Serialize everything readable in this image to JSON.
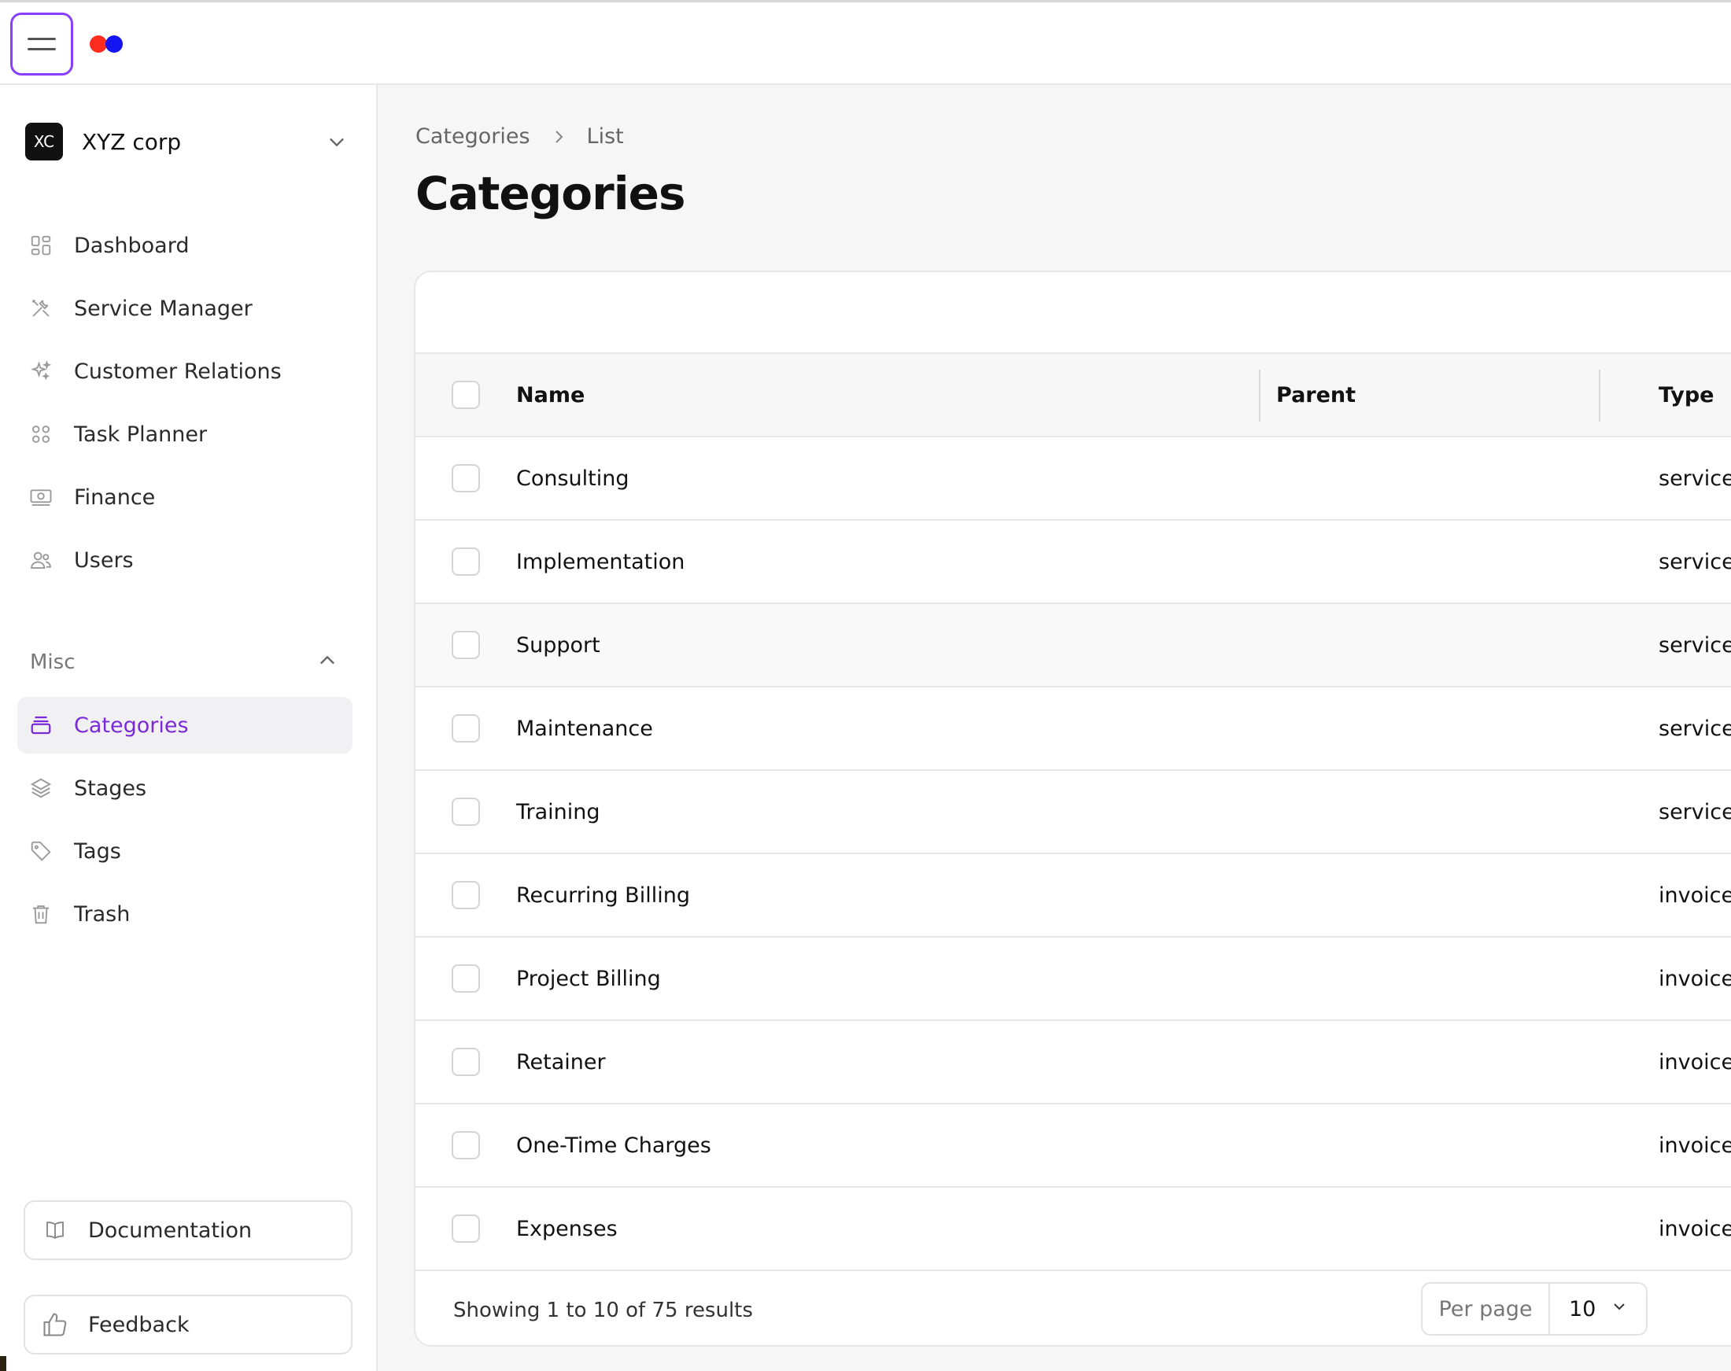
{
  "header": {
    "menu_icon": "hamburger-icon",
    "logo_colors": [
      "#ff2d20",
      "#1414f0"
    ]
  },
  "org": {
    "initials": "XC",
    "name": "XYZ corp"
  },
  "nav": [
    {
      "label": "Dashboard",
      "icon": "dashboard-icon"
    },
    {
      "label": "Service Manager",
      "icon": "tools-icon"
    },
    {
      "label": "Customer Relations",
      "icon": "sparkles-icon"
    },
    {
      "label": "Task Planner",
      "icon": "grid-icon"
    },
    {
      "label": "Finance",
      "icon": "banknote-icon"
    },
    {
      "label": "Users",
      "icon": "users-icon"
    }
  ],
  "misc": {
    "label": "Misc",
    "items": [
      {
        "label": "Categories",
        "icon": "archive-box-icon",
        "active": true
      },
      {
        "label": "Stages",
        "icon": "layers-icon"
      },
      {
        "label": "Tags",
        "icon": "tag-icon"
      },
      {
        "label": "Trash",
        "icon": "trash-icon"
      }
    ]
  },
  "footer_buttons": {
    "documentation": "Documentation",
    "feedback": "Feedback"
  },
  "breadcrumb": {
    "root": "Categories",
    "current": "List"
  },
  "page_title": "Categories",
  "table": {
    "headers": {
      "name": "Name",
      "parent": "Parent",
      "type": "Type"
    },
    "rows": [
      {
        "name": "Consulting",
        "parent": "",
        "type": "services"
      },
      {
        "name": "Implementation",
        "parent": "",
        "type": "services"
      },
      {
        "name": "Support",
        "parent": "",
        "type": "services"
      },
      {
        "name": "Maintenance",
        "parent": "",
        "type": "services"
      },
      {
        "name": "Training",
        "parent": "",
        "type": "services"
      },
      {
        "name": "Recurring Billing",
        "parent": "",
        "type": "invoices"
      },
      {
        "name": "Project Billing",
        "parent": "",
        "type": "invoices"
      },
      {
        "name": "Retainer",
        "parent": "",
        "type": "invoices"
      },
      {
        "name": "One-Time Charges",
        "parent": "",
        "type": "invoices"
      },
      {
        "name": "Expenses",
        "parent": "",
        "type": "invoices"
      }
    ]
  },
  "pagination": {
    "showing": "Showing 1 to 10 of 75 results",
    "per_page_label": "Per page",
    "per_page_value": "10"
  },
  "colors": {
    "accent": "#7a2ad6",
    "menu_border": "#8a3ffc"
  }
}
